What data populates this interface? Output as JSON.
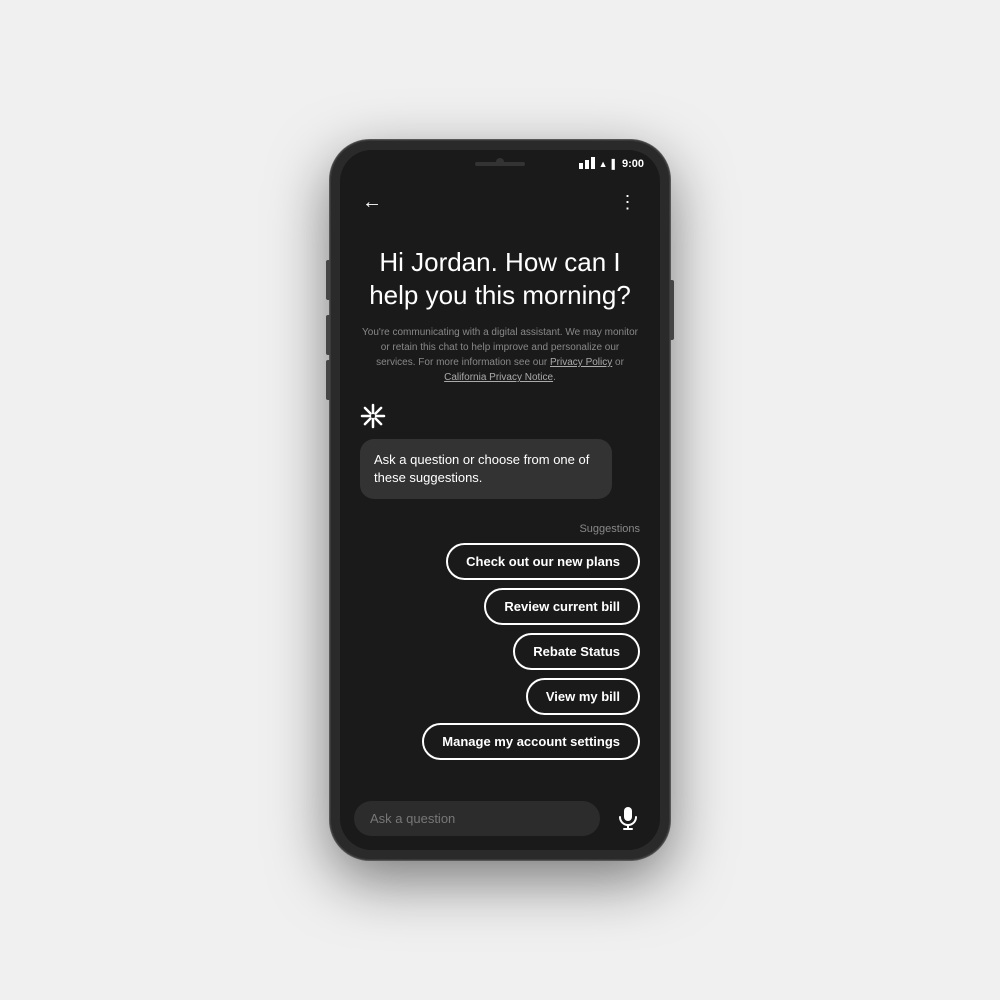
{
  "phone": {
    "status_bar": {
      "time": "9:00",
      "signal_icon": "▼▲",
      "battery_icon": "🔋"
    },
    "top_bar": {
      "back_icon": "←",
      "menu_icon": "⋮"
    },
    "greeting": {
      "title": "Hi Jordan. How can I help you this morning?",
      "disclaimer": "You're communicating with a digital assistant. We may monitor or retain this chat to help improve and personalize our services. For more information see our ",
      "privacy_policy_link": "Privacy Policy",
      "disclaimer_middle": " or ",
      "california_link": "California Privacy Notice",
      "disclaimer_end": "."
    },
    "chat_bubble": {
      "text": "Ask a question or choose from one of these suggestions."
    },
    "suggestions": {
      "label": "Suggestions",
      "items": [
        "Check out our new plans",
        "Review current bill",
        "Rebate Status",
        "View my bill",
        "Manage my account settings"
      ]
    },
    "input": {
      "placeholder": "Ask a question"
    },
    "mic_icon": "🎤"
  }
}
